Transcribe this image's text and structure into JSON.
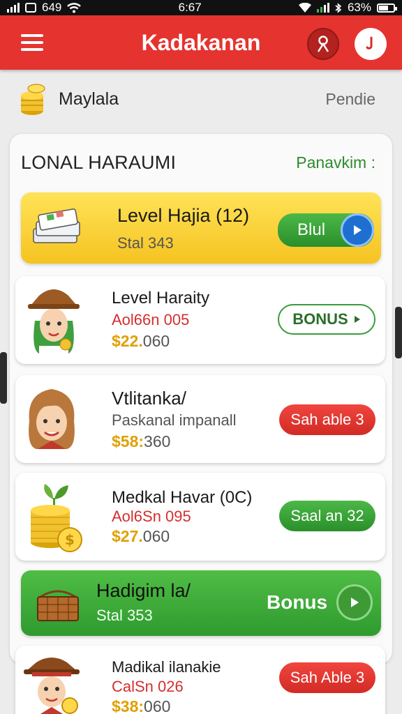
{
  "status_bar": {
    "left": "649",
    "time": "6:67",
    "battery": "63%",
    "battery_level": 0.63
  },
  "app_bar": {
    "title": "Kadakanan"
  },
  "balance": {
    "name": "Maylala",
    "status": "Pendie"
  },
  "panel": {
    "title": "LONAL HARAUMI",
    "link": "Panavkim :"
  },
  "cards": [
    {
      "title": "Level Hajia (12)",
      "sub": "Stal 343",
      "button": "Blul"
    },
    {
      "title": "Level Haraity",
      "sub": "Aol66n 005",
      "price_symbol": "$",
      "price_amount": "22.",
      "price_rest": "060",
      "button": "BONUS"
    },
    {
      "title": "Vtlitanka/",
      "sub": "Paskanal impanall",
      "price_symbol": "$",
      "price_amount": "58:",
      "price_rest": "360",
      "button": "Sah able 3"
    },
    {
      "title": "Medkal Havar (0C)",
      "sub": "Aol6Sn 095",
      "price_symbol": "$",
      "price_amount": "27.",
      "price_rest": "060",
      "button": "Saal an 32"
    },
    {
      "title": "Hadigim la/",
      "sub": "Stal 353",
      "button": "Bonus"
    },
    {
      "title": "Madikal ilanakie",
      "sub": "CalSn 026",
      "price_symbol": "$",
      "price_amount": "38:",
      "price_rest": "060",
      "button": "Sah Able 3"
    }
  ]
}
